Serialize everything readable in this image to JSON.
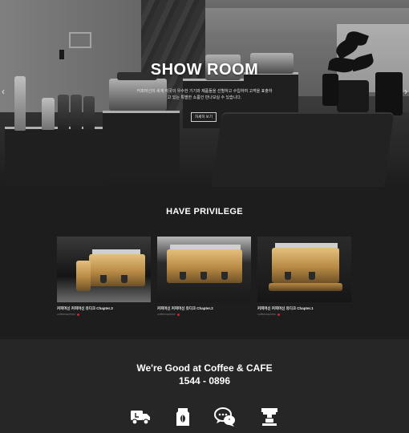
{
  "hero": {
    "title": "SHOW ROOM",
    "description": "커피머신의 세계 각국의 우수한 기기와 제품들을 선별하고 수입하여 고객을 표출하고 있는 특별한 쇼룸인 만나보실 수 있습니다.",
    "button_label": "자세히 보기",
    "prev_arrow": "‹",
    "next_arrow": "›"
  },
  "privilege": {
    "heading": "HAVE PRIVILEGE",
    "cards": [
      {
        "title": "커피머신 커피머신 유디크 Chapter.3",
        "meta": "coffeemachine"
      },
      {
        "title": "커피머신 커피머신 유디크 Chapter.2",
        "meta": "coffeemachine"
      },
      {
        "title": "커피머신 커피머신 유디크 Chapter.1",
        "meta": "coffeemachine"
      }
    ]
  },
  "footer": {
    "tagline": "We're Good at Coffee & CAFE",
    "phone": "1544 - 0896",
    "icons": [
      "delivery-truck-icon",
      "coffee-bag-icon",
      "chat-bubbles-icon",
      "espresso-machine-icon"
    ]
  }
}
